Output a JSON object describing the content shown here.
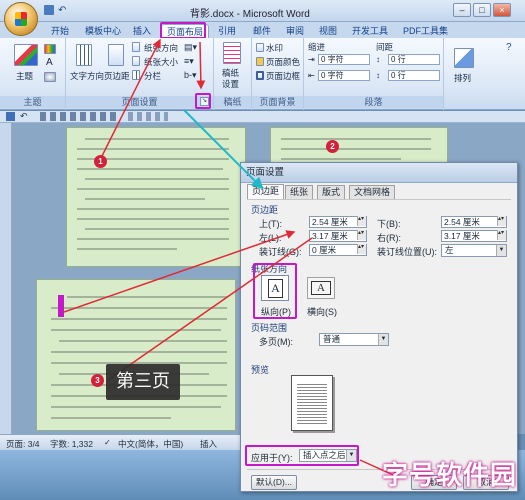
{
  "window": {
    "title": "背影.docx - Microsoft Word"
  },
  "tabs": [
    "开始",
    "模板中心",
    "插入",
    "页面布局",
    "引用",
    "邮件",
    "审阅",
    "视图",
    "开发工具",
    "PDF工具集"
  ],
  "ribbon": {
    "themes": {
      "label": "主题",
      "button": "主题"
    },
    "page_setup": {
      "label": "页面设置",
      "text_direction": "文字方向",
      "margins": "页边距",
      "orientation": "纸张方向",
      "size": "纸张大小",
      "columns": "分栏"
    },
    "draft": {
      "label": "稿纸",
      "button_line1": "稿纸",
      "button_line2": "设置"
    },
    "background": {
      "label": "页面背景",
      "watermark": "水印",
      "page_color": "页面颜色",
      "page_border": "页面边框"
    },
    "paragraph": {
      "label": "段落",
      "indent": "缩进",
      "spacing": "间距",
      "left_value": "0 字符",
      "right_value": "0 字符",
      "before_value": "0 行",
      "after_value": "0 行"
    },
    "arrange": {
      "button": "排列"
    }
  },
  "status": {
    "page": "页面: 3/4",
    "words": "字数: 1,332",
    "language": "中文(简体，中国)",
    "mode": "插入"
  },
  "dialog": {
    "title": "页面设置",
    "tabs": [
      "页边距",
      "纸张",
      "版式",
      "文档网格"
    ],
    "margins_section": "页边距",
    "top_label": "上(T):",
    "top_value": "2.54 厘米",
    "bottom_label": "下(B):",
    "bottom_value": "2.54 厘米",
    "left_label": "左(L):",
    "left_value": "3.17 厘米",
    "right_label": "右(R):",
    "right_value": "3.17 厘米",
    "gutter_label": "装订线(G):",
    "gutter_value": "0 厘米",
    "gutter_pos_label": "装订线位置(U):",
    "gutter_pos_value": "左",
    "orientation_section": "纸张方向",
    "portrait": "纵向(P)",
    "landscape": "横向(S)",
    "pages_section": "页码范围",
    "multiple_pages_label": "多页(M):",
    "multiple_pages_value": "普通",
    "preview_section": "预览",
    "apply_to_label": "应用于(Y):",
    "apply_to_value": "插入点之后",
    "default_button": "默认(D)...",
    "ok_button": "确定",
    "cancel_button": "取消"
  },
  "annotations": {
    "badge1": "1",
    "badge2": "2",
    "badge3": "3",
    "callout": "第三页",
    "watermark": "字号软件园"
  },
  "colors": {
    "highlight": "#c419c8",
    "arrow_red": "#e02a35",
    "arrow_cyan": "#1fb8c9",
    "page_bg": "#d9ecc9"
  }
}
